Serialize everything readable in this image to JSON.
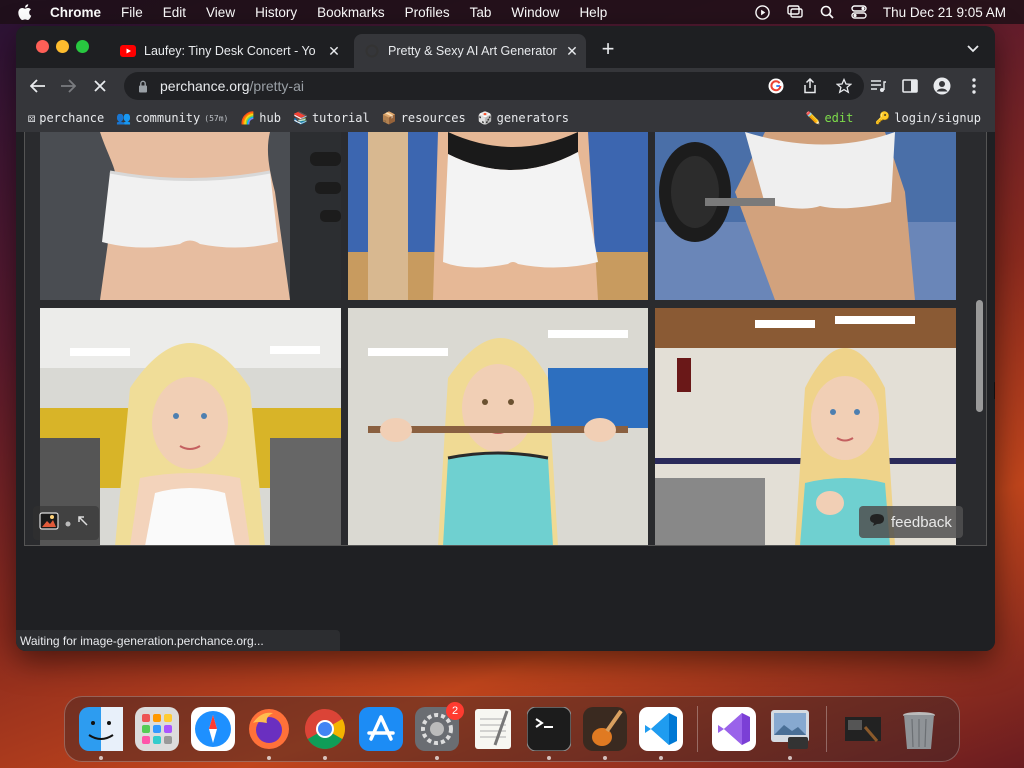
{
  "menubar": {
    "items": [
      "Chrome",
      "File",
      "Edit",
      "View",
      "History",
      "Bookmarks",
      "Profiles",
      "Tab",
      "Window",
      "Help"
    ],
    "clock": "Thu Dec 21  9:05 AM"
  },
  "tabs": [
    {
      "title": "Laufey: Tiny Desk Concert - Yo",
      "favicon": "youtube-icon",
      "active": false
    },
    {
      "title": "Pretty & Sexy AI Art Generator",
      "favicon": "perchance-icon",
      "active": true
    }
  ],
  "address": {
    "domain": "perchance.org",
    "path": "/pretty-ai"
  },
  "bookmarks": [
    {
      "icon": "⚄",
      "label": "perchance"
    },
    {
      "icon": "👥",
      "label": "community",
      "sub": "(57m)"
    },
    {
      "icon": "🌈",
      "label": "hub"
    },
    {
      "icon": "📚",
      "label": "tutorial"
    },
    {
      "icon": "📦",
      "label": "resources"
    },
    {
      "icon": "🎲",
      "label": "generators"
    }
  ],
  "bookmarks_right": [
    {
      "icon": "✏️",
      "label": "edit"
    },
    {
      "icon": "🔑",
      "label": "login/signup"
    }
  ],
  "feedback_label": "feedback",
  "status": "Waiting for image-generation.perchance.org...",
  "dock": {
    "apps": [
      "finder-icon",
      "launchpad-icon",
      "safari-icon",
      "firefox-icon",
      "chrome-icon",
      "app-store-icon",
      "system-settings-icon",
      "textedit-icon",
      "terminal-icon",
      "garageband-icon",
      "vscode-icon",
      "visual-studio-icon",
      "preview-icon",
      "downloads-stack-icon",
      "trash-icon"
    ],
    "settings_badge": "2"
  },
  "colors": {
    "chrome_dark": "#202124",
    "tab_active": "#35363a",
    "accent_edit": "#7ddc4a"
  }
}
